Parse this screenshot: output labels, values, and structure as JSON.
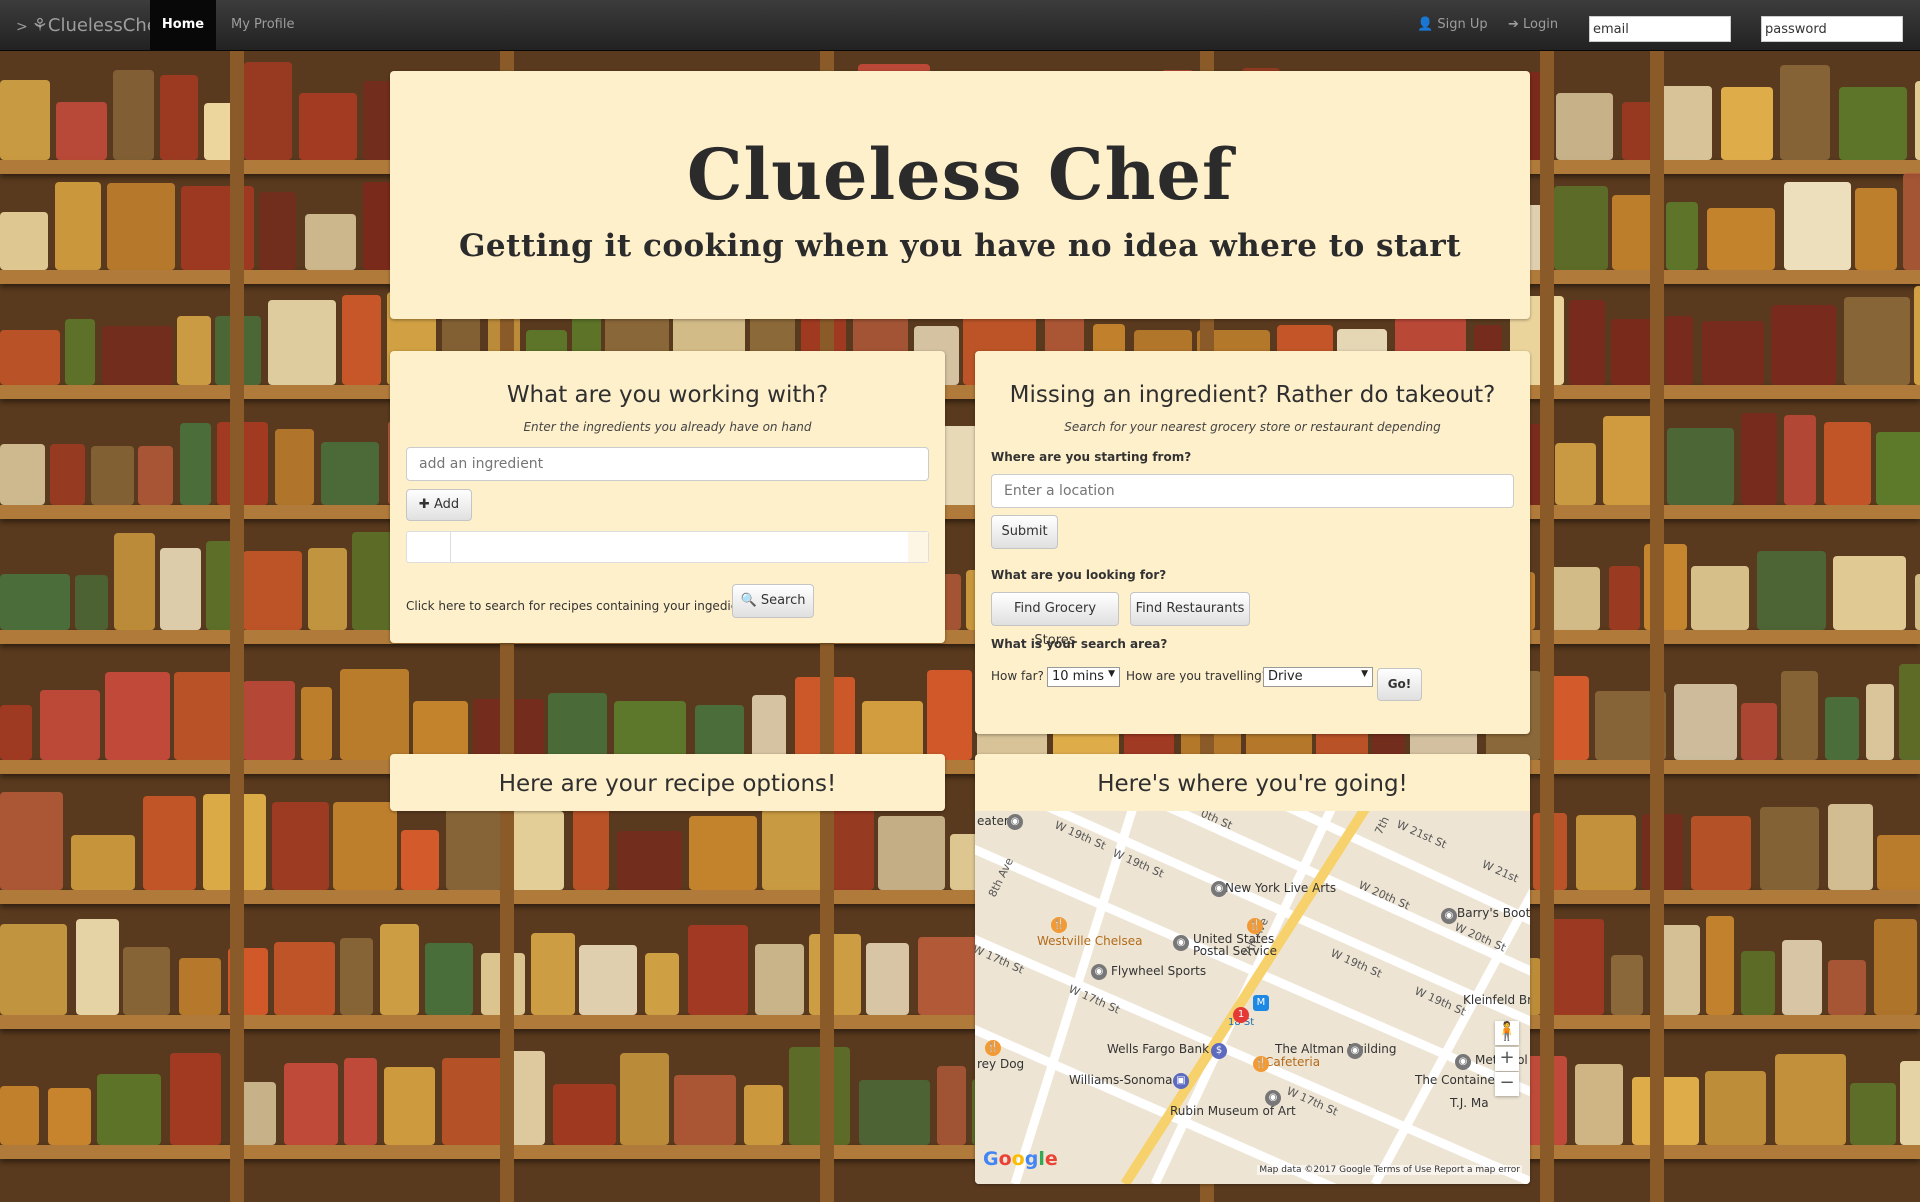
{
  "navbar": {
    "brand": "CluelessChef",
    "home": "Home",
    "profile": "My Profile",
    "signup": "Sign Up",
    "login": "Login",
    "email_value": "email",
    "password_value": "password"
  },
  "hero": {
    "title": "Clueless Chef",
    "subtitle": "Getting it cooking when you have no idea where to start"
  },
  "ingredients": {
    "title": "What are you working with?",
    "subtitle": "Enter the ingredients you already have on hand",
    "input_placeholder": "add an ingredient",
    "add_label": "Add",
    "search_prompt": "Click here to search for recipes containing your ingedients:",
    "search_label": "Search"
  },
  "takeout": {
    "title": "Missing an ingredient? Rather do takeout?",
    "subtitle": "Search for your nearest grocery store or restaurant depending",
    "start_label": "Where are you starting from?",
    "location_placeholder": "Enter a location",
    "submit_label": "Submit",
    "looking_label": "What are you looking for?",
    "grocery_label": "Find Grocery Stores",
    "restaurants_label": "Find Restaurants",
    "area_label": "What is your search area?",
    "how_far": "How far?",
    "far_value": "10 mins",
    "travel_q": "How are you travelling?",
    "travel_value": "Drive",
    "go_label": "Go!"
  },
  "recipes": {
    "title": "Here are your recipe options!"
  },
  "map": {
    "title": "Here's where you're going!",
    "places": {
      "new_york_live_arts": "New York Live Arts",
      "barrys_boot": "Barry's Boot",
      "westville": "Westville Chelsea",
      "usps_1": "United States",
      "usps_2": "Postal Service",
      "flywheel": "Flywheel Sports",
      "kleinfeld": "Kleinfeld Br",
      "wells_fargo": "Wells Fargo Bank",
      "altman_1": "The Altman Building",
      "altman_2": "Cafeteria",
      "metropol": "Metropol",
      "williams": "Williams-Sonoma",
      "container": "The Containe",
      "tj": "T.J. Ma",
      "rubin": "Rubin Museum of Art",
      "rey_dog": "rey Dog",
      "eater": "eater",
      "station": "18 St"
    },
    "streets": {
      "w19_a": "W 19th St",
      "w19_b": "W 19th St",
      "w20_a": "0th St",
      "w21_a": "W 21st St",
      "w21_b": "W 21st",
      "ave8": "8th Ave",
      "ave7": "7th Ave",
      "ave7b": "7th",
      "w20_b": "W 20th St",
      "w20_c": "W 20th St",
      "w19_c": "W 19th St",
      "w19_d": "W 19th St",
      "w17_a": "W 17th St",
      "w17_b": "W 17th St",
      "w17_c": "W 17th St"
    },
    "google": "Google",
    "attribution": "Map data ©2017 Google    Terms of Use    Report a map error",
    "zoom_in": "+",
    "zoom_out": "−"
  }
}
